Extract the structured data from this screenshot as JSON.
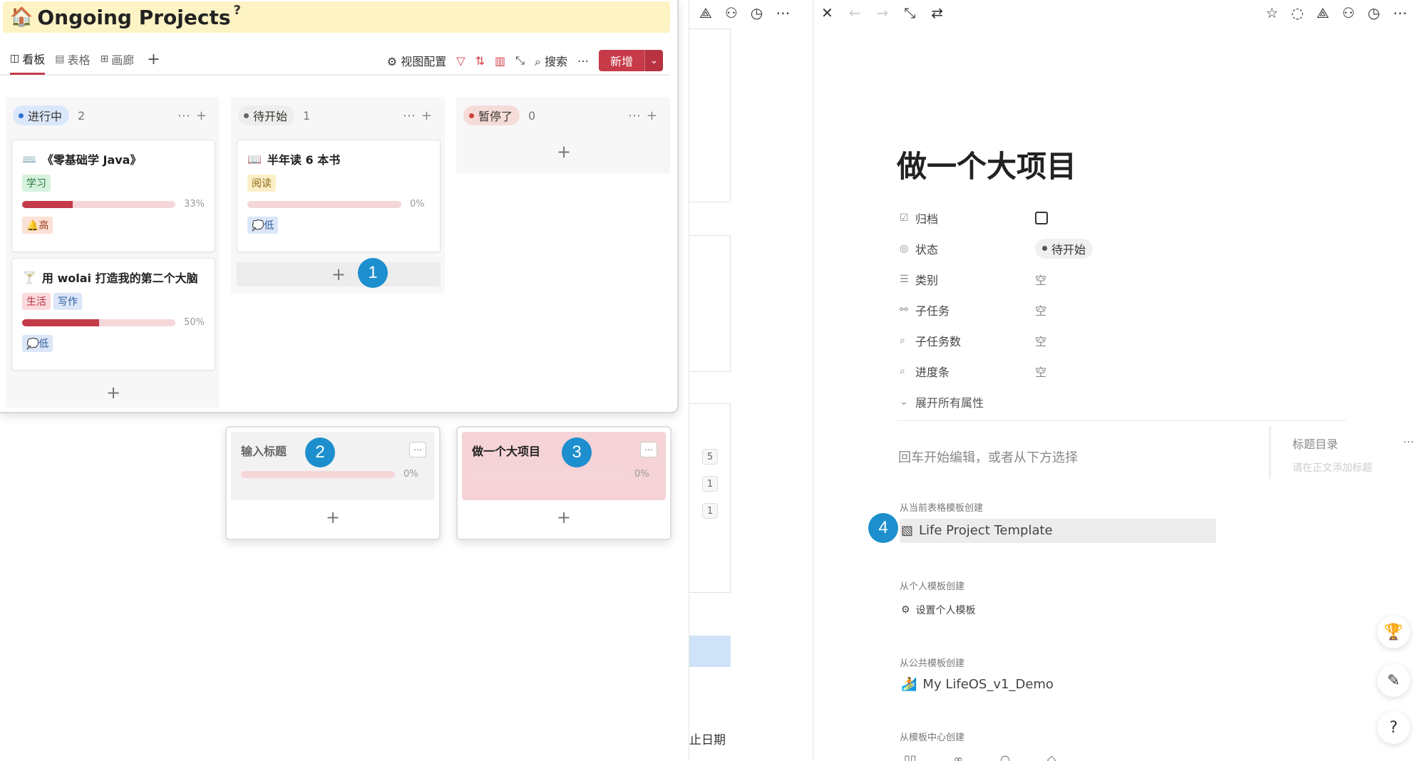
{
  "kanban": {
    "title": "Ongoing Projects",
    "title_emoji": "🏠",
    "title_help": "?",
    "tabs": [
      {
        "label": "看板",
        "icon": "board-icon",
        "active": true
      },
      {
        "label": "表格",
        "icon": "table-icon",
        "active": false
      },
      {
        "label": "画廊",
        "icon": "gallery-icon",
        "active": false
      }
    ],
    "toolbar": {
      "view_config": "视图配置",
      "search": "搜索",
      "new_label": "新增"
    },
    "columns": [
      {
        "label": "进行中",
        "count": "2",
        "pill_bg": "#dbe8fb",
        "dot": "#2f73d6"
      },
      {
        "label": "待开始",
        "count": "1",
        "pill_bg": "#eeeeee",
        "dot": "#666666"
      },
      {
        "label": "暂停了",
        "count": "0",
        "pill_bg": "#f6dcd8",
        "dot": "#c9433c"
      }
    ],
    "cards": [
      {
        "emoji": "⌨️",
        "title": "《零基础学 Java》",
        "tags": [
          {
            "text": "学习",
            "bg": "#d6f2de",
            "color": "#2a7a3f"
          }
        ],
        "progress": 0.33,
        "pct": "33%",
        "priority": {
          "text": "🔔高",
          "bg": "#fbe2d6",
          "color": "#9c3a1e"
        }
      },
      {
        "emoji": "🍸",
        "title": "用 wolai 打造我的第二个大脑",
        "tags": [
          {
            "text": "生活",
            "bg": "#fbd9dc",
            "color": "#b3303f"
          },
          {
            "text": "写作",
            "bg": "#dbe6f8",
            "color": "#2f5e9e"
          }
        ],
        "progress": 0.5,
        "pct": "50%",
        "priority": {
          "text": "💭低",
          "bg": "#dbe6f8",
          "color": "#2f5e9e"
        }
      },
      {
        "emoji": "📖",
        "title": "半年读 6 本书",
        "tags": [
          {
            "text": "阅读",
            "bg": "#fcefc8",
            "color": "#8a6a10"
          }
        ],
        "progress": 0,
        "pct": "0%",
        "priority": {
          "text": "💭低",
          "bg": "#dbe6f8",
          "color": "#2f5e9e"
        }
      }
    ],
    "add_symbol": "+",
    "float_cards": [
      {
        "title": "输入标题",
        "pct": "0%",
        "bg": "#f2f2f2",
        "title_color": "#666666"
      },
      {
        "title": "做一个大项目",
        "pct": "0%",
        "bg": "#f6d3d6",
        "title_color": "#222222"
      }
    ]
  },
  "markers": [
    "1",
    "2",
    "3",
    "4"
  ],
  "middle": {
    "numbers": [
      "5",
      "1",
      "1"
    ],
    "date_label": "止日期"
  },
  "page": {
    "title": "做一个大项目",
    "props": [
      {
        "icon": "checkbox-icon",
        "name": "归档",
        "value": ""
      },
      {
        "icon": "status-icon",
        "name": "状态",
        "value": "待开始"
      },
      {
        "icon": "list-icon",
        "name": "类别",
        "value": "空"
      },
      {
        "icon": "relation-icon",
        "name": "子任务",
        "value": "空"
      },
      {
        "icon": "lookup-icon",
        "name": "子任务数",
        "value": "空"
      },
      {
        "icon": "lookup-icon",
        "name": "进度条",
        "value": "空"
      }
    ],
    "expand_all": "展开所有属性",
    "editor_hint": "回车开始编辑，或者从下方选择",
    "toc_title": "标题目录",
    "toc_hint": "请在正文添加标题",
    "tpl_from_table": "从当前表格模板创建",
    "tpl_table_item": "Life Project Template",
    "tpl_from_personal": "从个人模板创建",
    "tpl_personal_item": "设置个人模板",
    "tpl_from_public": "从公共模板创建",
    "tpl_public_item": "My LifeOS_v1_Demo",
    "tpl_from_center": "从模板中心创建"
  },
  "colors": {
    "accent": "#c73a48",
    "marker": "#1d8fce",
    "title_bg": "#fdf3c4"
  }
}
